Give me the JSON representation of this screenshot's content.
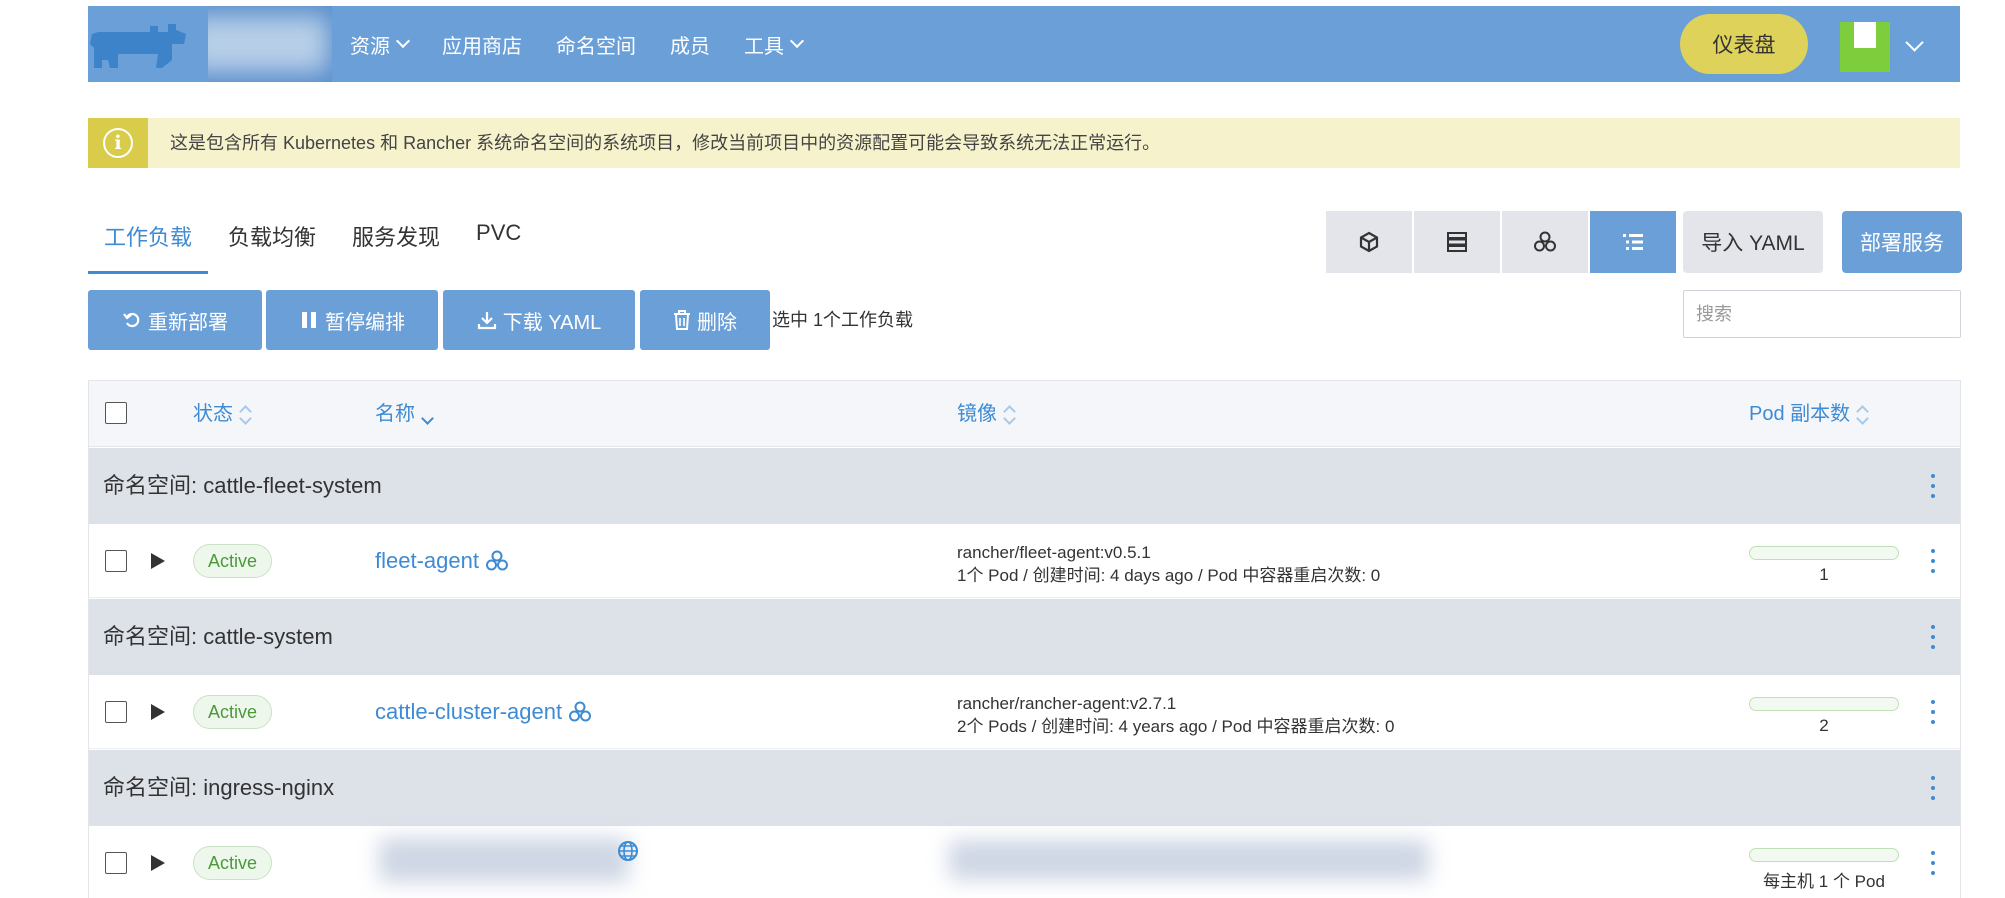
{
  "header": {
    "nav": [
      {
        "label": "资源",
        "has_dropdown": true
      },
      {
        "label": "应用商店",
        "has_dropdown": false
      },
      {
        "label": "命名空间",
        "has_dropdown": false
      },
      {
        "label": "成员",
        "has_dropdown": false
      },
      {
        "label": "工具",
        "has_dropdown": true
      }
    ],
    "dashboard_label": "仪表盘"
  },
  "banner": {
    "icon": "info-icon",
    "text": "这是包含所有 Kubernetes 和 Rancher 系统命名空间的系统项目，修改当前项目中的资源配置可能会导致系统无法正常运行。"
  },
  "tabs": [
    {
      "label": "工作负载",
      "active": true
    },
    {
      "label": "负载均衡",
      "active": false
    },
    {
      "label": "服务发现",
      "active": false
    },
    {
      "label": "PVC",
      "active": false
    }
  ],
  "view_modes": [
    "cube-icon",
    "server-icon",
    "cluster-icon",
    "list-icon"
  ],
  "buttons": {
    "import_yaml": "导入 YAML",
    "deploy": "部署服务"
  },
  "actions": {
    "redeploy": "重新部署",
    "pause": "暂停编排",
    "download_yaml": "下载 YAML",
    "delete": "删除",
    "selected_text": "选中 1个工作负载"
  },
  "search": {
    "placeholder": "搜索",
    "value": ""
  },
  "table": {
    "columns": {
      "status": "状态",
      "name": "名称",
      "image": "镜像",
      "pods": "Pod 副本数"
    },
    "groups": [
      {
        "namespace_label": "命名空间: cattle-fleet-system",
        "workload": {
          "status": "Active",
          "name": "fleet-agent",
          "image": "rancher/fleet-agent:v0.5.1",
          "details": "1个 Pod / 创建时间: 4 days ago / Pod 中容器重启次数: 0",
          "pods": "1"
        }
      },
      {
        "namespace_label": "命名空间: cattle-system",
        "workload": {
          "status": "Active",
          "name": "cattle-cluster-agent",
          "image": "rancher/rancher-agent:v2.7.1",
          "details": "2个 Pods / 创建时间: 4 years ago / Pod 中容器重启次数: 0",
          "pods": "2"
        }
      },
      {
        "namespace_label": "命名空间: ingress-nginx",
        "workload": {
          "status": "Active",
          "pods": "每主机 1 个 Pod"
        }
      }
    ]
  },
  "colors": {
    "primary": "#6b9fd7",
    "link": "#3d8bd4",
    "warning": "#d8cc4a",
    "dashboard": "#ded25a",
    "active_badge": "#4a9a3a"
  }
}
